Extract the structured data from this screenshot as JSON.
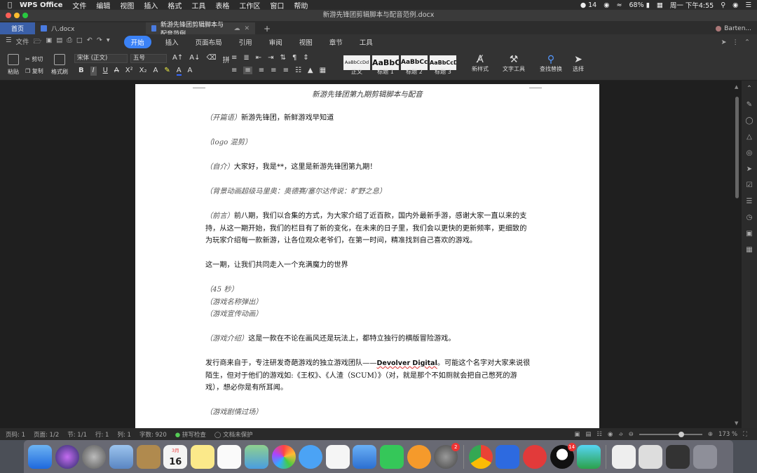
{
  "menubar": {
    "app_name": "WPS Office",
    "menus": [
      "文件",
      "编辑",
      "视图",
      "插入",
      "格式",
      "工具",
      "表格",
      "工作区",
      "窗口",
      "帮助"
    ],
    "notification_count": "14",
    "battery": "68%",
    "clock": "周一 下午4:55"
  },
  "window": {
    "title": "新游先锋团剪辑脚本与配音范例.docx"
  },
  "tabs": {
    "home": "首页",
    "tab1": "八.docx",
    "tab2": "新游先锋团剪辑脚本与配音范例",
    "user": "Barten..."
  },
  "ribbon_tabs": {
    "file": "文件",
    "items": [
      "开始",
      "插入",
      "页面布局",
      "引用",
      "审阅",
      "视图",
      "章节",
      "工具"
    ]
  },
  "ribbon": {
    "paste": "粘贴",
    "cut": "剪切",
    "copy": "复制",
    "format_painter": "格式刷",
    "font": "宋体 (正文)",
    "size": "五号",
    "styles": [
      {
        "preview": "AaBbCcDd",
        "label": "正文"
      },
      {
        "preview": "AaBbC",
        "label": "标题 1"
      },
      {
        "preview": "AaBbCc",
        "label": "标题 2"
      },
      {
        "preview": "AaBbCcD",
        "label": "标题 3"
      }
    ],
    "new_style": "新样式",
    "text_tools": "文字工具",
    "find_replace": "查找替换",
    "select": "选择"
  },
  "document": {
    "header": "新游先锋团第九期剪辑脚本与配音",
    "paragraphs": [
      {
        "stage": "（开篇语）",
        "text": "新游先锋团，新鲜游戏早知道"
      },
      {
        "stage": "（logo 混剪）",
        "text": ""
      },
      {
        "stage": "（自介）",
        "text": "大家好，我是**，这里是新游先锋团第九期！"
      },
      {
        "stage": "（背景动画超级马里奥：奥德赛/塞尔达传说：旷野之息）",
        "text": ""
      },
      {
        "stage": "（前言）",
        "text": "前八期，我们以合集的方式，为大家介绍了近百款，国内外最新手游，感谢大家一直以来的支持，从这一期开始，我们的栏目有了新的变化，在未来的日子里，我们会以更快的更新频率，更细致的为玩家介绍每一款新游，让各位观众老爷们，在第一时间，精准找到自己喜欢的游戏。"
      },
      {
        "stage": "",
        "text": "这一期，让我们共同走入一个充满魔力的世界"
      }
    ],
    "block_lines": [
      "（45 秒）",
      "（游戏名称弹出）",
      "（游戏宣传动画）"
    ],
    "intro": {
      "stage": "（游戏介绍）",
      "text": "这是一款在不论在画风还是玩法上，都特立独行的横版冒险游戏。"
    },
    "dev_para": {
      "before": "发行商来自于，专注研发奇葩游戏的独立游戏团队——",
      "name": "Devolver Digital",
      "after": "。可能这个名字对大家来说很陌生，但对于他们的游戏如:《王权》、《人渣（SCUM）》（对，就是那个不如厕就会把自己憋死的游戏），想必你是有所耳闻。"
    },
    "last": "（游戏剧情过场）"
  },
  "status": {
    "page": "页码: 1",
    "pages": "页面: 1/2",
    "section": "节: 1/1",
    "row": "行: 1",
    "col": "列: 1",
    "words": "字数: 920",
    "spell": "拼写检查",
    "protect": "文档未保护",
    "zoom": "173 %"
  },
  "dock": {
    "calendar_month": "3月",
    "calendar_day": "16",
    "sysprefs_badge": "2",
    "qq_badge": "14"
  }
}
